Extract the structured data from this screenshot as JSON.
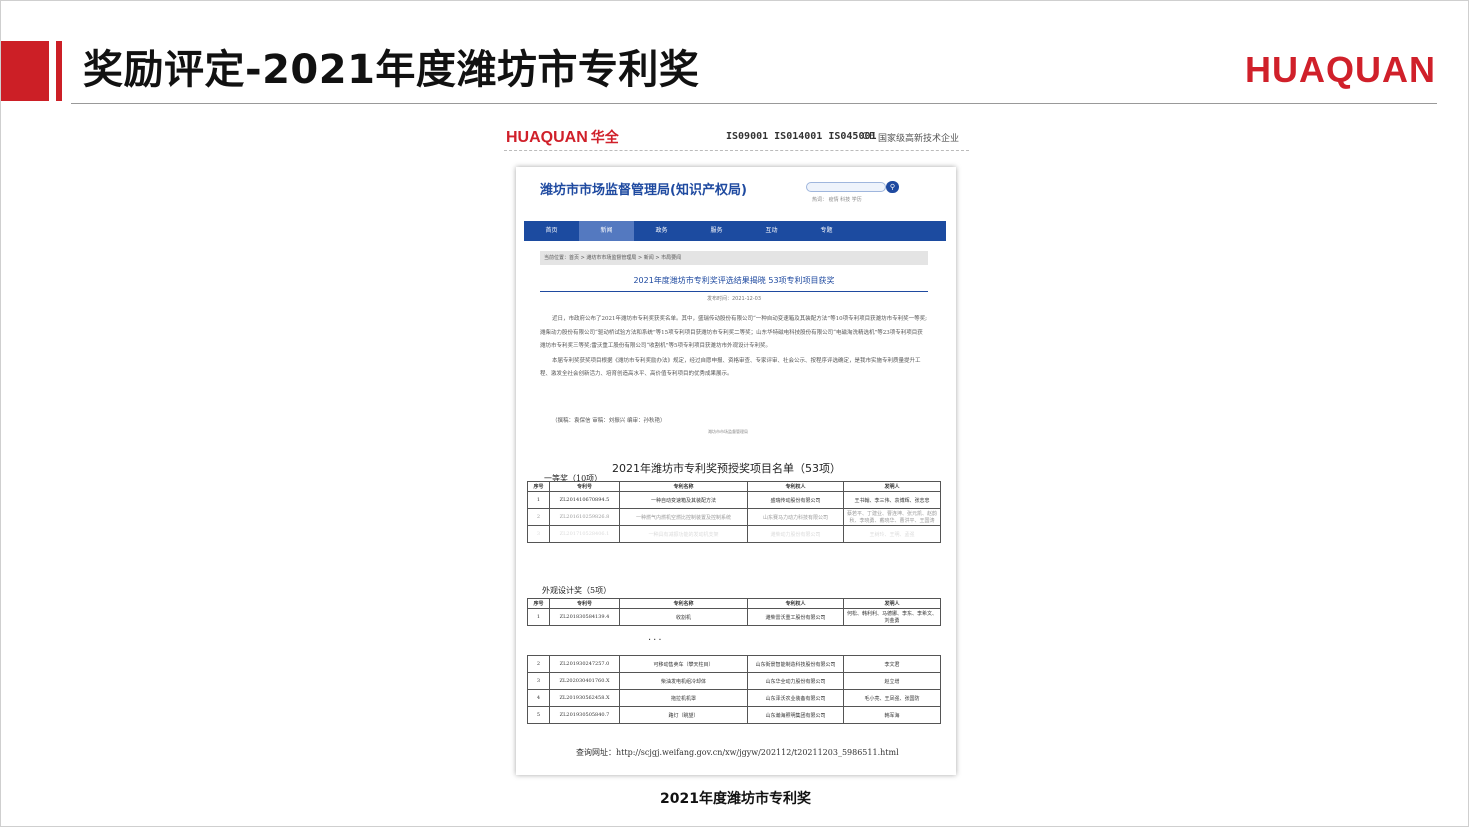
{
  "slide": {
    "title": "奖励评定-2021年度潍坊市专利奖",
    "logo": "HUAQUAN",
    "caption": "2021年度潍坊市专利奖"
  },
  "doc_header": {
    "logo": "HUAQUAN",
    "logo_cn": "华全",
    "iso": "IS09001 IS014001 IS045001",
    "ce": "CE",
    "hitech": "国家级高新技术企业"
  },
  "site": {
    "name": "潍坊市市场监督管理局(知识产权局)",
    "search_hot": "热词：  疫情  科技  学历",
    "nav": [
      "首页",
      "新闻",
      "政务",
      "服务",
      "互动",
      "专题"
    ],
    "nav_active": 1,
    "breadcrumb": "当前位置：首页 > 潍坊市市场监督管理局 > 新闻 > 市局要闻",
    "article_title": "2021年度潍坊市专利奖评选结果揭晓 53项专利项目获奖",
    "article_date": "发布时间：2021-12-03",
    "body_p1": "近日，市政府公布了2021年潍坊市专利奖获奖名单。其中，盛瑞传动股份有限公司“一种自动变速箱及其装配方法”等10项专利项目获潍坊市专利奖一等奖;潍柴动力股份有限公司“驱动桥试验方法和系统”等15项专利项目获潍坊市专利奖二等奖；山东华特磁电科技股份有限公司“电磁淘洗精选机”等23项专利项目获潍坊市专利奖三等奖;雷沃重工股份有限公司“收割机”等5项专利项目获潍坊市外观设计专利奖。",
    "body_p2": "本届专利奖获奖项目根据《潍坊市专利奖励办法》规定，经过自愿申报、资格审查、专家评审、社会公示、按程序评选确定，是我市实施专利质量提升工程、激发全社会创新活力、培育创造高水平、高价值专利项目的优秀成果展示。",
    "sign": "（撰稿：袁保信    审稿：刘振兴    编审：孙秋艳）",
    "stamp": "潍坊市市场监督管理局"
  },
  "list": {
    "title": "2021年潍坊市专利奖预授奖项目名单（53项）",
    "first_section": "一等奖（10项）",
    "design_section": "外观设计奖（5项）",
    "headers": [
      "序号",
      "专利号",
      "专利名称",
      "专利权人",
      "发明人"
    ],
    "first_rows": [
      [
        "1",
        "ZL201410670894.5",
        "一种自动变速箱及其装配方法",
        "盛瑞传动股份有限公司",
        "王书翰、李三伟、袁博辉、张志忠"
      ],
      [
        "2",
        "ZL201610259826.8",
        "一种燃气内燃机空燃比控制装置及控制系统",
        "山东赛马力动力科技有限公司",
        "蔡若平、丁建业、曹连坤、张元凯、赵韵秋、李晓勇、戴晓华、曹洪平、王国涛"
      ],
      [
        "3",
        "ZL201710528406.1",
        "一种具有减振功能的发动机支架",
        "潍柴动力股份有限公司",
        "王树玲、王明、孟强"
      ]
    ],
    "design_rows": [
      [
        "1",
        "ZL201830584139.4",
        "收割机",
        "潍柴雷沃重工股份有限公司",
        "何松、韩利利、马德娜、李东、李希文、刘金勇"
      ]
    ],
    "dots": "···",
    "design_rows_more": [
      [
        "2",
        "ZL201930247257.0",
        "可移动售卖车（攀天柱目）",
        "山东街景智能制造科技股份有限公司",
        "李文君"
      ],
      [
        "3",
        "ZL202030401760.X",
        "柴油发电机组冷却体",
        "山东华全动力股份有限公司",
        "赵立增"
      ],
      [
        "4",
        "ZL201930562458.X",
        "拖拉机机罩",
        "山东泽沃农业装备有限公司",
        "毛小亮、王凤强、张国防"
      ],
      [
        "5",
        "ZL201930505840.7",
        "路灯（眺望）",
        "山东瀚海照明集团有限公司",
        "韩军海"
      ]
    ],
    "query": "查询网址：http://scjgj.weifang.gov.cn/xw/jgyw/202112/t20211203_5986511.html"
  },
  "colors": {
    "accent": "#cc1f26",
    "site_blue": "#1c4ba0"
  }
}
